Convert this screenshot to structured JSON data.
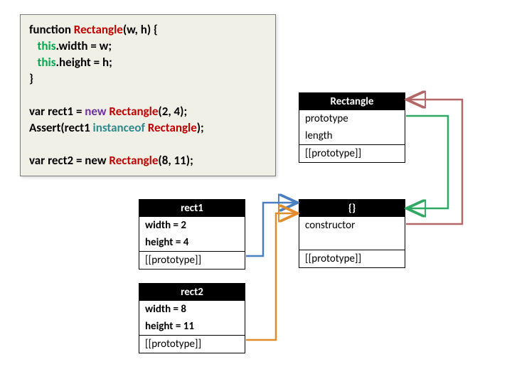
{
  "code": {
    "l1a": "function ",
    "l1b": "Rectangle",
    "l1c": "(w, h) {",
    "l2a": "this",
    "l2b": ".width = w;",
    "l3a": "this",
    "l3b": ".height = h;",
    "l4": "}",
    "l5a": "var rect1 = ",
    "l5b": "new ",
    "l5c": "Rectangle",
    "l5d": "(2, 4);",
    "l6a": "Assert(rect1 ",
    "l6b": "instanceof ",
    "l6c": "Rectangle",
    "l6d": ");",
    "l7a": "var rect2 = new ",
    "l7b": "Rectangle",
    "l7c": "(8, 11);"
  },
  "rectangle_box": {
    "title": "Rectangle",
    "p1": "prototype",
    "p2": "length",
    "p3": "[[prototype]]"
  },
  "empty_box": {
    "title": "{}",
    "p1": "constructor",
    "p2": "[[prototype]]"
  },
  "rect1_box": {
    "title": "rect1",
    "p1": "width = 2",
    "p2": "height = 4",
    "p3": "[[prototype]]"
  },
  "rect2_box": {
    "title": "rect2",
    "p1": "width = 8",
    "p2": "height = 11",
    "p3": "[[prototype]]"
  },
  "colors": {
    "blue": "#4a7fbf",
    "orange": "#e08b2c",
    "green": "#2fa862",
    "dullred": "#b26666"
  }
}
